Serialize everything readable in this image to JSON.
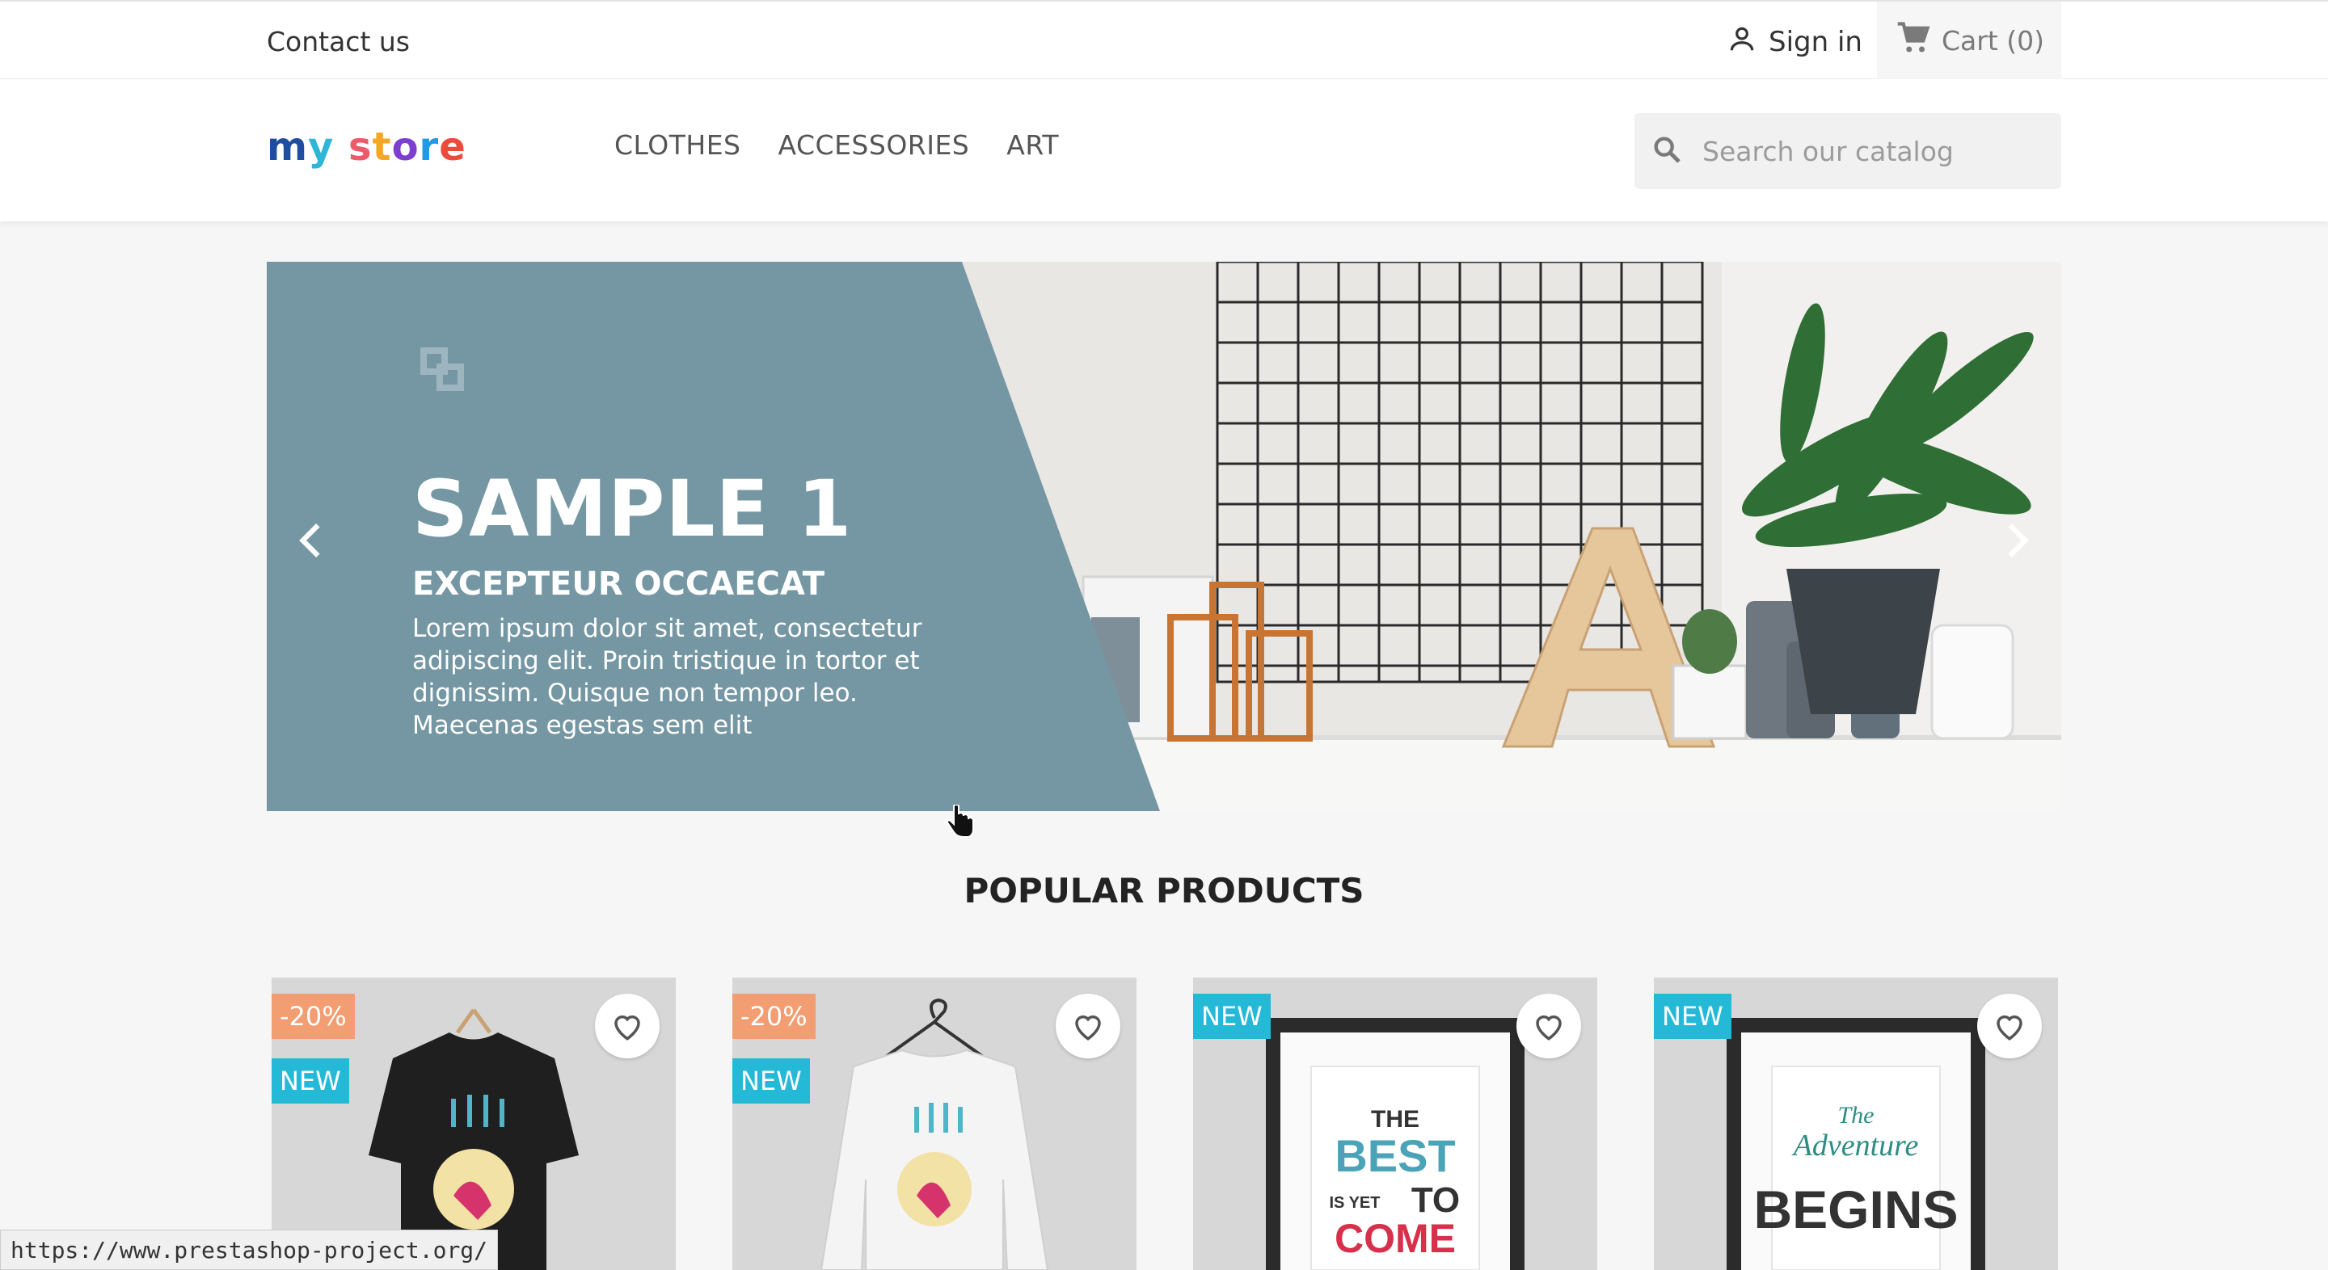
{
  "topnav": {
    "contact": "Contact us",
    "signin": "Sign in",
    "cart": "Cart (0)"
  },
  "header": {
    "logo_parts": [
      "m",
      "y",
      " ",
      "s",
      "t",
      "o",
      "r",
      "e"
    ],
    "menu": [
      "CLOTHES",
      "ACCESSORIES",
      "ART"
    ],
    "search_placeholder": "Search our catalog"
  },
  "slider": {
    "title": "SAMPLE 1",
    "subtitle": "EXCEPTEUR OCCAECAT",
    "body": "Lorem ipsum dolor sit amet, consectetur adipiscing elit. Proin tristique in tortor et dignissim. Quisque non tempor leo. Maecenas egestas sem elit",
    "panel_color": "#7497a3"
  },
  "section": {
    "title": "POPULAR PRODUCTS"
  },
  "products": [
    {
      "flags": [
        "-20%",
        "NEW"
      ],
      "kind": "black-tshirt"
    },
    {
      "flags": [
        "-20%",
        "NEW"
      ],
      "kind": "white-sweater"
    },
    {
      "flags": [
        "NEW"
      ],
      "kind": "poster-best"
    },
    {
      "flags": [
        "NEW"
      ],
      "kind": "poster-adventure"
    }
  ],
  "poster_text": {
    "best": [
      "THE",
      "BEST",
      "IS YET",
      "TO",
      "COME"
    ],
    "adventure": [
      "The",
      "Adventure",
      "BEGINS"
    ]
  },
  "status_url": "https://www.prestashop-project.org/",
  "colors": {
    "discount_flag": "#f39d72",
    "new_flag": "#24b9d7"
  }
}
